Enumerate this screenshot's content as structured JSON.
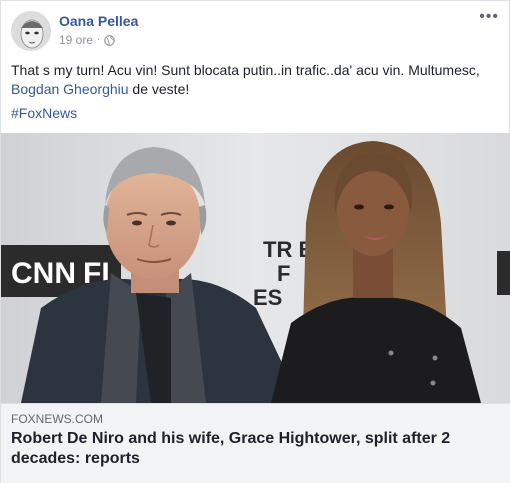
{
  "post": {
    "author": "Oana Pellea",
    "timestamp": "19 ore",
    "separator": "·",
    "privacy_icon": "globe-icon",
    "more_icon": "more-horizontal-icon",
    "more_label": "•••",
    "text_part1": "That s my turn! Acu vin! Sunt blocata putin..in trafic..da' acu vin. Multumesc, ",
    "mention": "Bogdan Gheorghiu",
    "text_part2": " de veste!",
    "hashtag": "#FoxNews"
  },
  "photo": {
    "signage_left": "CNN",
    "signage_partial": "FI",
    "signage_right_1": "TR  B",
    "signage_right_2": "F",
    "signage_right_3": "ES"
  },
  "link_preview": {
    "domain": "FOXNEWS.COM",
    "title": "Robert De Niro and his wife, Grace Hightower, split after 2 decades: reports"
  },
  "colors": {
    "link": "#365899",
    "text": "#1d2129",
    "muted": "#90949c",
    "preview_bg": "#f2f3f5",
    "border": "#dddfe2"
  }
}
